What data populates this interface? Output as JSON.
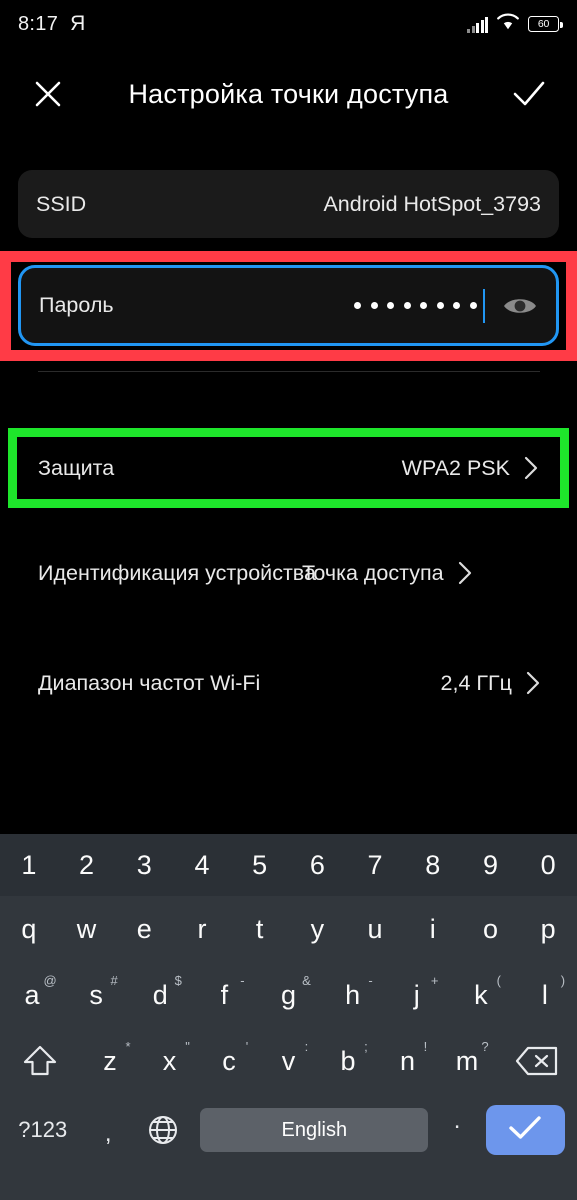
{
  "status_bar": {
    "time": "8:17",
    "assistant_icon_label": "Я",
    "battery_level": "60",
    "icons": [
      "signal-bars-icon",
      "wifi-icon",
      "battery-icon"
    ]
  },
  "app_bar": {
    "close_icon": "close-icon",
    "title": "Настройка точки доступа",
    "confirm_icon": "check-icon"
  },
  "settings": {
    "ssid": {
      "label": "SSID",
      "value": "Android HotSpot_3793"
    },
    "password": {
      "label": "Пароль",
      "masked_value": "••••••••",
      "dots": 8,
      "toggle_icon": "eye-icon"
    },
    "security": {
      "label": "Защита",
      "value": "WPA2 PSK",
      "chevron": "chevron-right-icon"
    },
    "identity": {
      "label": "Идентификация устройства",
      "value": "Точка доступа",
      "chevron": "chevron-right-icon"
    },
    "band": {
      "label": "Диапазон частот Wi-Fi",
      "value": "2,4 ГГц",
      "chevron": "chevron-right-icon"
    }
  },
  "highlights": {
    "password_box_color": "#ff3b46",
    "security_box_color": "#1ee62b"
  },
  "keyboard": {
    "number_row": [
      "1",
      "2",
      "3",
      "4",
      "5",
      "6",
      "7",
      "8",
      "9",
      "0"
    ],
    "row1": [
      "q",
      "w",
      "e",
      "r",
      "t",
      "y",
      "u",
      "i",
      "o",
      "p"
    ],
    "row2": [
      {
        "key": "a",
        "sup": "@"
      },
      {
        "key": "s",
        "sup": "#"
      },
      {
        "key": "d",
        "sup": "$"
      },
      {
        "key": "f",
        "sup": "-"
      },
      {
        "key": "g",
        "sup": "&"
      },
      {
        "key": "h",
        "sup": "-"
      },
      {
        "key": "j",
        "sup": "+"
      },
      {
        "key": "k",
        "sup": "("
      },
      {
        "key": "l",
        "sup": ")"
      }
    ],
    "row3": [
      {
        "key": "z",
        "sup": "*"
      },
      {
        "key": "x",
        "sup": "\""
      },
      {
        "key": "c",
        "sup": "'"
      },
      {
        "key": "v",
        "sup": ":"
      },
      {
        "key": "b",
        "sup": ";"
      },
      {
        "key": "n",
        "sup": "!"
      },
      {
        "key": "m",
        "sup": "?"
      }
    ],
    "shift_icon": "shift-icon",
    "backspace_icon": "backspace-icon",
    "symbols_key": "?123",
    "comma_key": ",",
    "globe_icon": "globe-icon",
    "spacebar_label": "English",
    "period_key": ".",
    "enter_icon": "check-icon"
  }
}
